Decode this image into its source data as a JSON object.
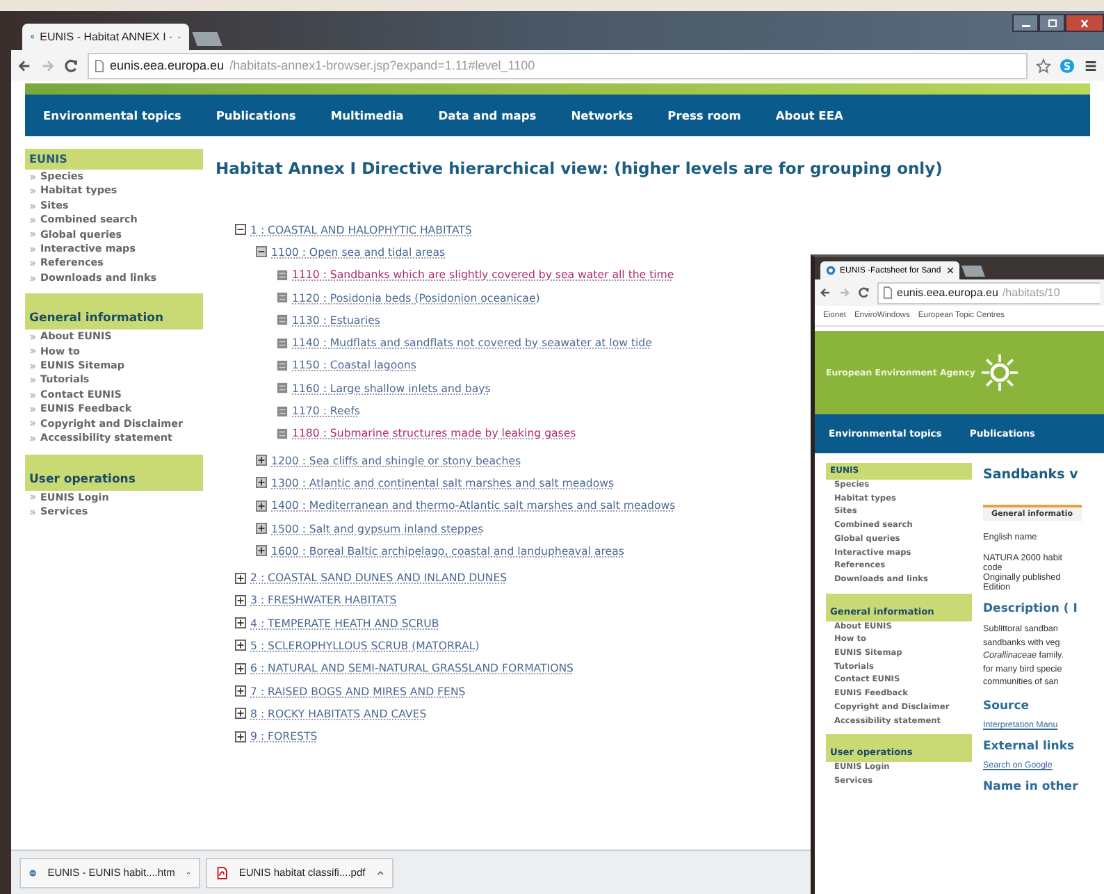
{
  "main_window": {
    "tab_title": "EUNIS - Habitat ANNEX I ·",
    "url_host": "eunis.eea.europa.eu",
    "url_path": "/habitats-annex1-browser.jsp?expand=1.11#level_1100",
    "nav": [
      "Environmental topics",
      "Publications",
      "Multimedia",
      "Data and maps",
      "Networks",
      "Press room",
      "About EEA"
    ],
    "sidebar": [
      {
        "title": "EUNIS",
        "items": [
          "Species",
          "Habitat types",
          "Sites",
          "Combined search",
          "Global queries",
          "Interactive maps",
          "References",
          "Downloads and links"
        ]
      },
      {
        "title": "General information",
        "items": [
          "About EUNIS",
          "How to",
          "EUNIS Sitemap",
          "Tutorials",
          "Contact EUNIS",
          "EUNIS Feedback",
          "Copyright and Disclaimer",
          "Accessibility statement"
        ]
      },
      {
        "title": "User operations",
        "items": [
          "EUNIS Login",
          "Services"
        ]
      }
    ],
    "heading": "Habitat Annex I Directive hierarchical view: (higher levels are for grouping only)",
    "tree": [
      {
        "label": "1 : COASTAL AND HALOPHYTIC HABITATS",
        "expanded": true,
        "children": [
          {
            "label": "1100 : Open sea and tidal areas",
            "expanded": true,
            "children": [
              {
                "label": "1110 : Sandbanks which are slightly covered by sea water all the time",
                "visited": true
              },
              {
                "label": "1120 : Posidonia beds (Posidonion oceanicae)",
                "visited": false
              },
              {
                "label": "1130 : Estuaries",
                "visited": false
              },
              {
                "label": "1140 : Mudflats and sandflats not covered by seawater at low tide",
                "visited": false
              },
              {
                "label": "1150 : Coastal lagoons",
                "visited": false
              },
              {
                "label": "1160 : Large shallow inlets and bays",
                "visited": false
              },
              {
                "label": "1170 : Reefs",
                "visited": false
              },
              {
                "label": "1180 : Submarine structures made by leaking gases",
                "visited": true
              }
            ]
          },
          {
            "label": "1200 : Sea cliffs and shingle or stony beaches",
            "expanded": false
          },
          {
            "label": "1300 : Atlantic and continental salt marshes and salt meadows",
            "expanded": false
          },
          {
            "label": "1400 : Mediterranean and thermo-Atlantic salt marshes and salt meadows",
            "expanded": false
          },
          {
            "label": "1500 : Salt and gypsum inland steppes",
            "expanded": false
          },
          {
            "label": "1600 : Boreal Baltic archipelago, coastal and landupheaval areas",
            "expanded": false
          }
        ]
      },
      {
        "label": "2 : COASTAL SAND DUNES AND INLAND DUNES",
        "expanded": false
      },
      {
        "label": "3 : FRESHWATER HABITATS",
        "expanded": false
      },
      {
        "label": "4 : TEMPERATE HEATH AND SCRUB",
        "expanded": false
      },
      {
        "label": "5 : SCLEROPHYLLOUS SCRUB (MATORRAL)",
        "expanded": false
      },
      {
        "label": "6 : NATURAL AND SEMI-NATURAL GRASSLAND FORMATIONS",
        "expanded": false
      },
      {
        "label": "7 : RAISED BOGS AND MIRES AND FENS",
        "expanded": false
      },
      {
        "label": "8 : ROCKY HABITATS AND CAVES",
        "expanded": false
      },
      {
        "label": "9 : FORESTS",
        "expanded": false
      }
    ],
    "downloads": [
      {
        "name": "EUNIS - EUNIS habit....htm",
        "kind": "html"
      },
      {
        "name": "EUNIS habitat classifi....pdf",
        "kind": "pdf"
      }
    ]
  },
  "second_window": {
    "tab_title": "EUNIS -Factsheet for Sand",
    "url_host": "eunis.eea.europa.eu",
    "url_path": "/habitats/10",
    "bookmarks": [
      "Eionet",
      "EnviroWindows",
      "European Topic Centres"
    ],
    "banner": "European Environment Agency",
    "nav": [
      "Environmental topics",
      "Publications"
    ],
    "sidebar": [
      {
        "title": "EUNIS",
        "items": [
          "Species",
          "Habitat types",
          "Sites",
          "Combined search",
          "Global queries",
          "Interactive maps",
          "References",
          "Downloads and links"
        ]
      },
      {
        "title": "General information",
        "items": [
          "About EUNIS",
          "How to",
          "EUNIS Sitemap",
          "Tutorials",
          "Contact EUNIS",
          "EUNIS Feedback",
          "Copyright and Disclaimer",
          "Accessibility statement"
        ]
      },
      {
        "title": "User operations",
        "items": [
          "EUNIS Login",
          "Services"
        ]
      }
    ],
    "heading": "Sandbanks v",
    "tab": "General informatio",
    "fields": [
      "English name",
      "NATURA 2000 habit",
      "code",
      "Originally published",
      "Edition"
    ],
    "description_heading": "Description ( I",
    "description_lines": [
      "Sublittoral sandban",
      "sandbanks with veg",
      "*Corallinaceae* family.",
      "for many bird specie",
      "communities of san"
    ],
    "source_heading": "Source",
    "source_link": "Interpretation Manu",
    "links_heading": "External links",
    "links_link": "Search on Google",
    "other_heading": "Name in other"
  }
}
